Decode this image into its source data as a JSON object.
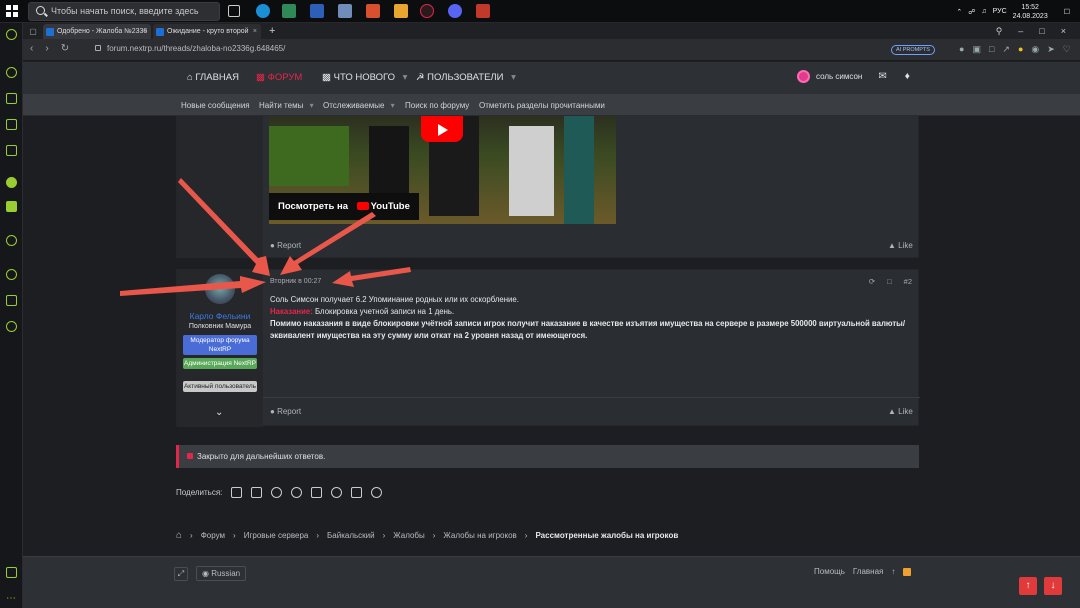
{
  "taskbar": {
    "search_placeholder": "Чтобы начать поиск, введите здесь запрос",
    "lang": "РУС",
    "time": "15:52",
    "date": "24.08.2023"
  },
  "browser": {
    "tabs": [
      {
        "label": "Одобрено - Жалоба №2336",
        "active": true
      },
      {
        "label": "Ожидание - круто второй",
        "active": false
      }
    ],
    "url": "forum.nextrp.ru/threads/zhaloba-no2336g.648465/",
    "ai_prompts": "AI PROMPTS"
  },
  "nav": {
    "home": "ГЛАВНАЯ",
    "forums": "ФОРУМ",
    "whats_new": "ЧТО НОВОГО",
    "members": "ПОЛЬЗОВАТЕЛИ",
    "username": "соль симсон"
  },
  "subnav": [
    "Новые сообщения",
    "Найти темы",
    "Отслеживаемые",
    "Поиск по форуму",
    "Отметить разделы прочитанными"
  ],
  "post1": {
    "watch_label": "Посмотреть на",
    "youtube": "YouTube",
    "report": "Report",
    "like": "Like"
  },
  "post2": {
    "author": "Карло Фельини",
    "rank": "Полковник Мамура",
    "badges": [
      "Модератор форума NextRP",
      "Администрация NextRP",
      "Активный пользователь"
    ],
    "date": "Вторник в 00:27",
    "number": "#2",
    "line1": "Соль Симсон получает 6.2 Упоминание родных или их оскорбление.",
    "penalty_label": "Наказание:",
    "penalty_text": "Блокировка учетной записи на 1 день.",
    "line3": "Помимо наказания в виде блокировки учётной записи игрок получит наказание в качестве изъятия имущества на сервере в размере 500000 виртуальной валюты/эквивалент имущества на эту сумму или откат на 2 уровня назад от имеющегося.",
    "report": "Report",
    "like": "Like"
  },
  "closed": "Закрыто для дальнейших ответов.",
  "share_label": "Поделиться:",
  "breadcrumbs": [
    "Форум",
    "Игровые сервера",
    "Байкальский",
    "Жалобы",
    "Жалобы на игроков",
    "Рассмотренные жалобы на игроков"
  ],
  "footer": {
    "language": "Russian",
    "help": "Помощь",
    "home": "Главная"
  },
  "colors": {
    "accent": "#e3264a",
    "moderator": "#4a6cd6",
    "admin": "#59a85a",
    "annotation_arrow": "#e8574a"
  }
}
